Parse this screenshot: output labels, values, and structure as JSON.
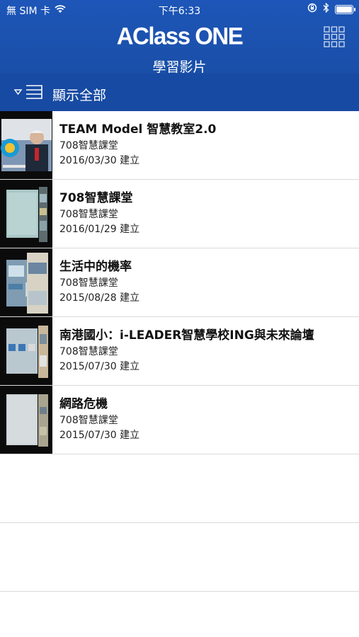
{
  "status_bar": {
    "carrier": "無 SIM 卡",
    "time": "下午6:33",
    "battery_level": 1.0
  },
  "header": {
    "logo": "AClass ONE",
    "subtitle": "學習影片",
    "menu_icon": "grid-icon"
  },
  "filter": {
    "label": "顯示全部",
    "icon": "filter-list-icon"
  },
  "videos": [
    {
      "title": "TEAM Model 智慧教室2.0",
      "channel": "708智慧課堂",
      "date": "2016/03/30 建立"
    },
    {
      "title": "708智慧課堂",
      "channel": "708智慧課堂",
      "date": "2016/01/29 建立"
    },
    {
      "title": "生活中的機率",
      "channel": "708智慧課堂",
      "date": "2015/08/28 建立"
    },
    {
      "title": "南港國小：i-LEADER智慧學校ING與未來論壇",
      "channel": "708智慧課堂",
      "date": "2015/07/30 建立"
    },
    {
      "title": "網路危機",
      "channel": "708智慧課堂",
      "date": "2015/07/30 建立"
    }
  ],
  "colors": {
    "header": "#1d56b8",
    "filter_bar": "#174aa3",
    "divider": "#dadada"
  }
}
